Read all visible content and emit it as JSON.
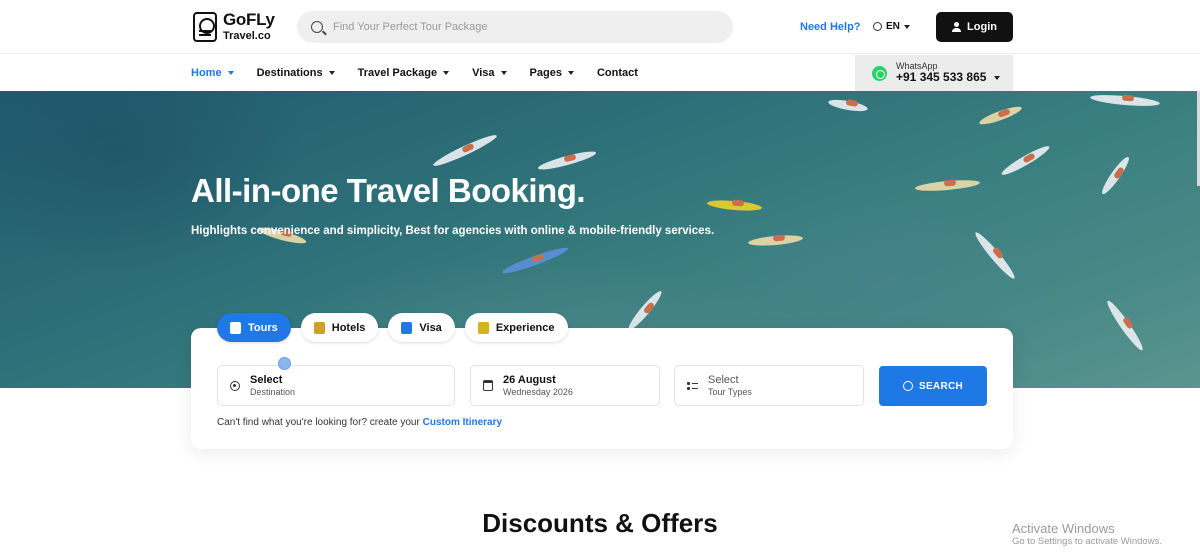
{
  "header": {
    "logo_name": "GoFLy",
    "logo_sub": "Travel.co",
    "search_placeholder": "Find Your Perfect Tour Package",
    "help_label": "Need Help?",
    "lang_label": "EN",
    "login_label": "Login"
  },
  "nav": {
    "items": [
      {
        "label": "Home",
        "active": true
      },
      {
        "label": "Destinations"
      },
      {
        "label": "Travel Package"
      },
      {
        "label": "Visa"
      },
      {
        "label": "Pages"
      },
      {
        "label": "Contact"
      }
    ],
    "whatsapp_label": "WhatsApp",
    "whatsapp_number": "+91 345 533 865"
  },
  "hero": {
    "title": "All-in-one Travel Booking.",
    "subtitle": "Highlights convenience and simplicity, Best for agencies with online & mobile-friendly services."
  },
  "booking": {
    "tabs": [
      {
        "label": "Tours",
        "icon": "luggage-icon",
        "active": true
      },
      {
        "label": "Hotels",
        "icon": "bed-icon"
      },
      {
        "label": "Visa",
        "icon": "passport-icon"
      },
      {
        "label": "Experience",
        "icon": "activity-icon"
      }
    ],
    "destination_value": "Select",
    "destination_sub": "Destination",
    "date_value": "26 August",
    "date_sub": "Wednesday 2026",
    "type_value": "Select",
    "type_sub": "Tour Types",
    "search_label": "SEARCH",
    "help_text": "Can't find what you're looking for? create your",
    "help_link": "Custom Itinerary"
  },
  "section": {
    "title": "Discounts & Offers"
  },
  "watermark": {
    "line1": "Activate Windows",
    "line2": "Go to Settings to activate Windows."
  },
  "colors": {
    "accent": "#1e78e6",
    "dark": "#111111",
    "whatsapp": "#25d366"
  }
}
